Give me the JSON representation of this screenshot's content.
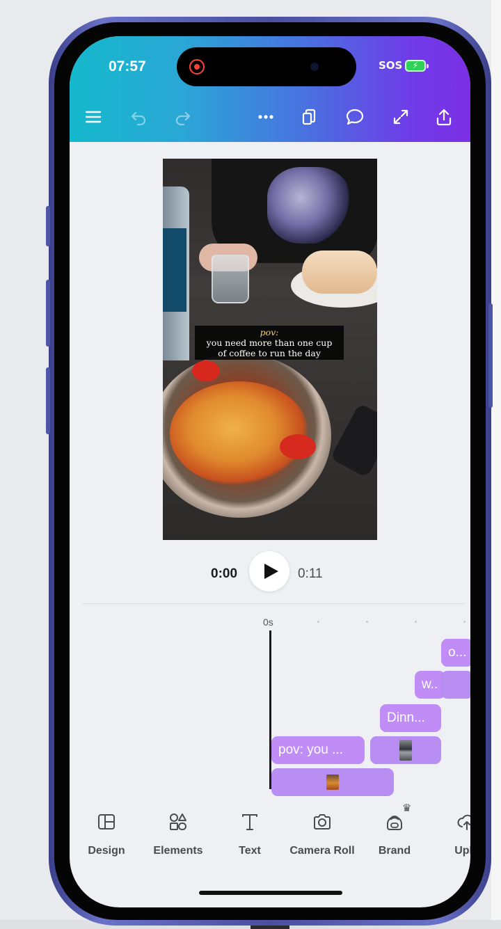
{
  "status_bar": {
    "time": "07:57",
    "sos": "SOS",
    "battery_glyph": "⚡"
  },
  "toolbar": {
    "icons": [
      "menu-icon",
      "undo-icon",
      "redo-icon",
      "more-icon",
      "pages-icon",
      "comment-icon",
      "fullscreen-icon",
      "share-icon"
    ],
    "accent_start": "#14b9cc",
    "accent_end": "#7c2fe6"
  },
  "video": {
    "caption_line1": "pov:",
    "caption_line2": "you need more than one cup",
    "caption_line3": "of coffee to run the day"
  },
  "player": {
    "current_time": "0:00",
    "total_time": "0:11"
  },
  "timeline": {
    "ruler_label": "0s",
    "clips": [
      "o...",
      "w..",
      "Dinn...",
      "pov: you ..."
    ],
    "clip_color": "#c08cf5"
  },
  "tools": [
    {
      "label": "Design",
      "icon": "design-icon"
    },
    {
      "label": "Elements",
      "icon": "elements-icon"
    },
    {
      "label": "Text",
      "icon": "text-icon"
    },
    {
      "label": "Camera Roll",
      "icon": "camera-icon"
    },
    {
      "label": "Brand",
      "icon": "brand-icon"
    },
    {
      "label": "Uplo",
      "icon": "upload-icon"
    }
  ]
}
